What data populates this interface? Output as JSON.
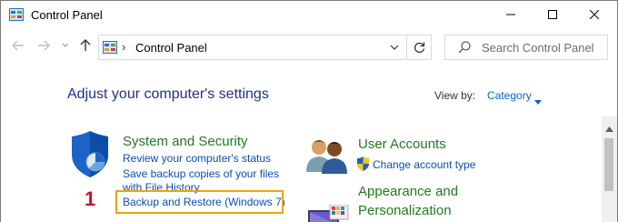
{
  "window": {
    "title": "Control Panel",
    "icon": "control-panel-icon"
  },
  "address": {
    "path": "Control Panel",
    "separator": "›"
  },
  "search": {
    "placeholder": "Search Control Panel"
  },
  "content": {
    "heading": "Adjust your computer's settings",
    "view_by_label": "View by:",
    "view_by_value": "Category"
  },
  "categories": [
    {
      "title": "System and Security",
      "icon": "shield-icon",
      "links": [
        "Review your computer's status",
        "Save backup copies of your files",
        "with File History",
        "Backup and Restore (Windows 7)"
      ]
    },
    {
      "title": "User Accounts",
      "icon": "users-icon",
      "links": [
        "Change account type"
      ]
    },
    {
      "title": "Appearance and",
      "title2": "Personalization",
      "icon": "monitor-icon",
      "links": []
    }
  ],
  "annotation": {
    "number": "1",
    "color": "#c8102e",
    "highlight_color": "#f0a30a"
  },
  "colors": {
    "heading": "#1e3287",
    "category_title": "#1f7a1f",
    "link": "#0a4eb0"
  }
}
